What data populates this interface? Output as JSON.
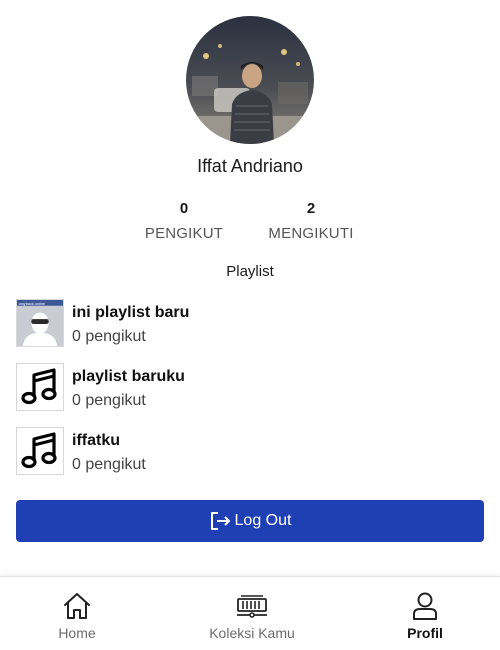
{
  "profile": {
    "name": "Iffat Andriano",
    "followers_count": "0",
    "followers_label": "PENGIKUT",
    "following_count": "2",
    "following_label": "MENGIKUTI"
  },
  "playlist_section": {
    "title": "Playlist",
    "items": [
      {
        "title": "ini playlist baru",
        "subtitle": "0 pengikut",
        "thumb": "user-photo-thumbnail",
        "thumb_caption": "wayback.online"
      },
      {
        "title": "playlist baruku",
        "subtitle": "0 pengikut",
        "thumb": "music-note-icon"
      },
      {
        "title": "iffatku",
        "subtitle": "0 pengikut",
        "thumb": "music-note-icon"
      }
    ]
  },
  "logout": {
    "label": "Log Out",
    "icon": "logout-icon",
    "color": "#1f3fb4"
  },
  "nav": {
    "items": [
      {
        "label": "Home",
        "icon": "home-icon",
        "active": false
      },
      {
        "label": "Koleksi Kamu",
        "icon": "library-icon",
        "active": false
      },
      {
        "label": "Profil",
        "icon": "user-icon",
        "active": true
      }
    ]
  }
}
